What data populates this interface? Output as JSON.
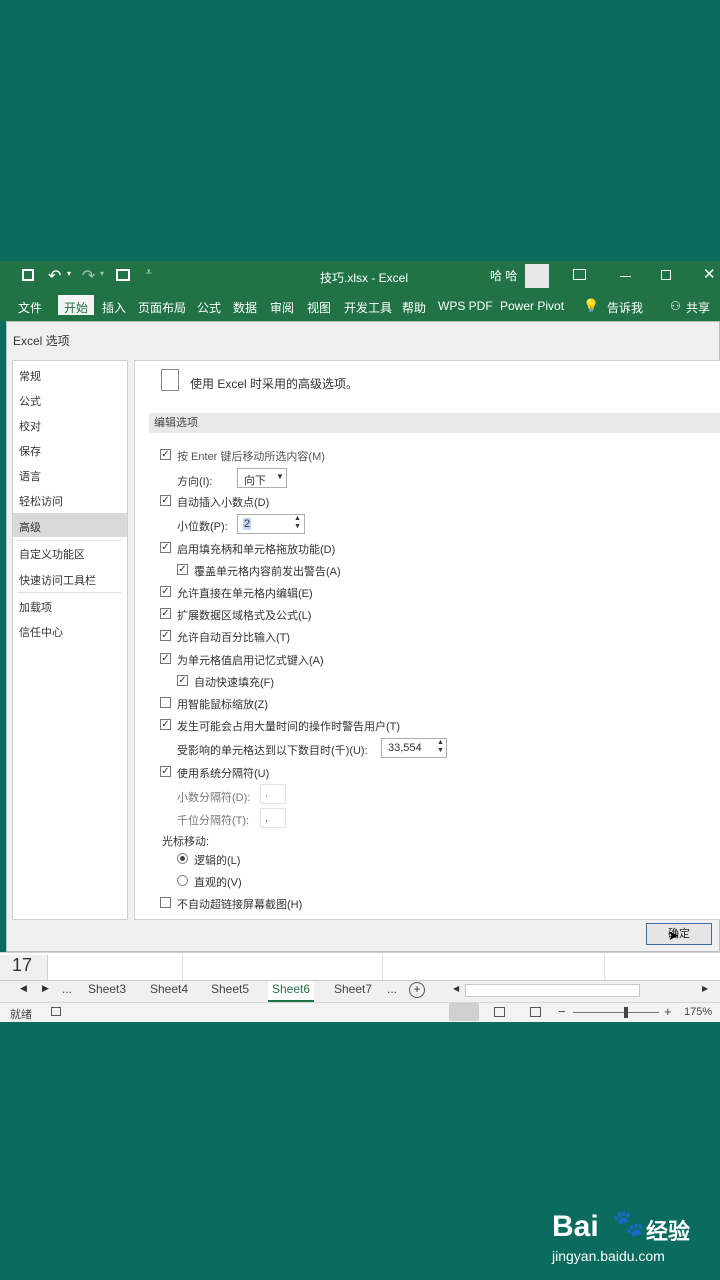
{
  "titlebar": {
    "title": "技巧.xlsx - Excel",
    "user": "哈 哈"
  },
  "ribbon": {
    "tabs": [
      "文件",
      "开始",
      "插入",
      "页面布局",
      "公式",
      "数据",
      "审阅",
      "视图",
      "开发工具",
      "帮助",
      "WPS PDF",
      "Power Pivot",
      "告诉我",
      "共享"
    ],
    "active_tab": "开始"
  },
  "dialog": {
    "title": "Excel 选项",
    "nav": [
      "常规",
      "公式",
      "校对",
      "保存",
      "语言",
      "轻松访问",
      "高级",
      "自定义功能区",
      "快速访问工具栏",
      "加载项",
      "信任中心"
    ],
    "selected_nav": "高级",
    "header": "使用 Excel 时采用的高级选项。",
    "section": "编辑选项",
    "options": {
      "enter_move": "按 Enter 键后移动所选内容(M)",
      "direction_label": "方向(I):",
      "direction_value": "向下",
      "auto_decimal": "自动插入小数点(D)",
      "places_label": "小位数(P):",
      "places_value": "2",
      "fill_handle": "启用填充柄和单元格拖放功能(D)",
      "overwrite_alert": "覆盖单元格内容前发出警告(A)",
      "edit_in_cell": "允许直接在单元格内编辑(E)",
      "extend_formats": "扩展数据区域格式及公式(L)",
      "auto_percent": "允许自动百分比输入(T)",
      "autocomplete": "为单元格值启用记忆式键入(A)",
      "flash_fill": "自动快速填充(F)",
      "intellimouse_zoom": "用智能鼠标缩放(Z)",
      "warn_long_ops": "发生可能会占用大量时间的操作时警告用户(T)",
      "cells_label": "受影响的单元格达到以下数目时(千)(U):",
      "cells_value": "33,554",
      "system_separators": "使用系统分隔符(U)",
      "decimal_sep_label": "小数分隔符(D):",
      "decimal_sep_value": ".",
      "thousands_sep_label": "千位分隔符(T):",
      "thousands_sep_value": ",",
      "cursor_movement": "光标移动:",
      "logical": "逻辑的(L)",
      "visual": "直观的(V)",
      "no_hyperlink_screenshot": "不自动超链接屏幕截图(H)"
    },
    "ok_button": "确定"
  },
  "sheet": {
    "row_number": "17",
    "tabs": [
      "...",
      "Sheet3",
      "Sheet4",
      "Sheet5",
      "Sheet6",
      "Sheet7",
      "..."
    ],
    "active_tab": "Sheet6"
  },
  "statusbar": {
    "status": "就绪",
    "zoom": "175%"
  },
  "watermark": {
    "brand": "Bai",
    "brand2": "经验",
    "url": "jingyan.baidu.com"
  }
}
